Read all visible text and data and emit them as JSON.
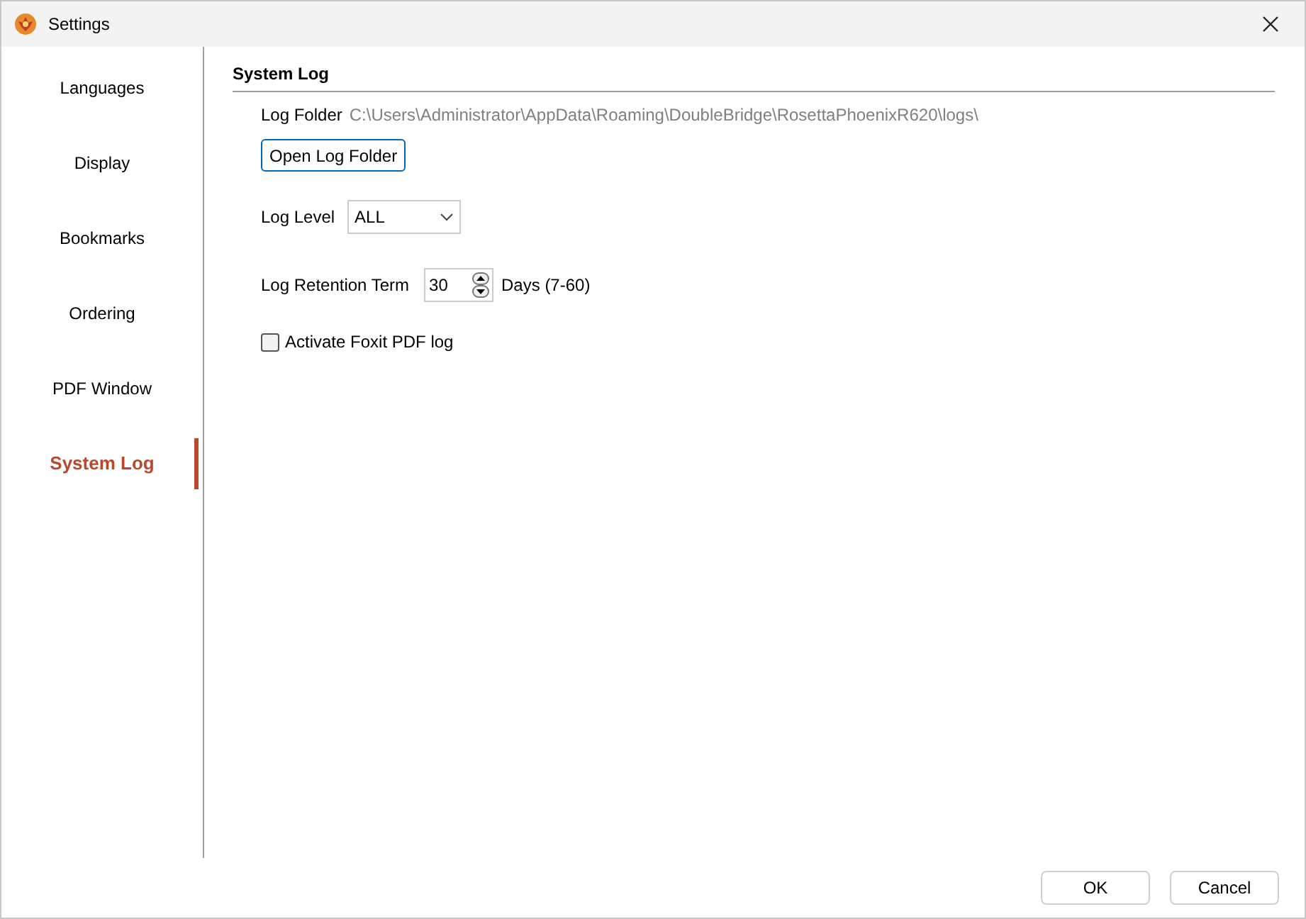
{
  "window": {
    "title": "Settings"
  },
  "sidebar": {
    "items": [
      {
        "label": "Languages",
        "selected": false
      },
      {
        "label": "Display",
        "selected": false
      },
      {
        "label": "Bookmarks",
        "selected": false
      },
      {
        "label": "Ordering",
        "selected": false
      },
      {
        "label": "PDF Window",
        "selected": false
      },
      {
        "label": "System Log",
        "selected": true
      }
    ]
  },
  "section": {
    "title": "System Log",
    "log_folder": {
      "label": "Log Folder",
      "value": "C:\\Users\\Administrator\\AppData\\Roaming\\DoubleBridge\\RosettaPhoenixR620\\logs\\"
    },
    "open_button": "Open Log Folder",
    "log_level": {
      "label": "Log Level",
      "value": "ALL"
    },
    "retention": {
      "label": "Log Retention Term",
      "value": "30",
      "unit": "Days (7-60)"
    },
    "foxit_log": {
      "label": "Activate Foxit PDF log",
      "checked": false
    }
  },
  "buttons": [
    "OK",
    "Cancel"
  ]
}
